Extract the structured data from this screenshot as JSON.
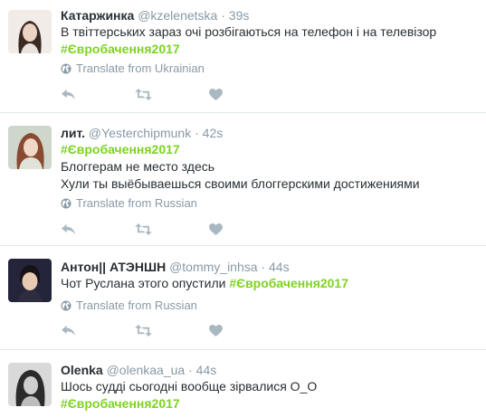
{
  "colors": {
    "hashtag": "#7ed321",
    "muted": "#8899a6",
    "text": "#292f33",
    "divider": "#e1e8ed"
  },
  "icons": {
    "reply": "reply-icon",
    "retweet": "retweet-icon",
    "like": "heart-icon",
    "translate": "globe-icon"
  },
  "tweets": [
    {
      "name": "Катаржинка",
      "handle": "@kzelenetska",
      "separator": "·",
      "time": "39s",
      "lines": [
        "В твіттерських зараз очі розбігаються на телефон і на телевізор"
      ],
      "hashtag": "#Євробачення2017",
      "translate": "Translate from Ukrainian"
    },
    {
      "name": "лит.",
      "handle": "@Yesterchipmunk",
      "separator": "·",
      "time": "42s",
      "hashtag": "#Євробачення2017",
      "lines": [
        "Блоггерам не место здесь",
        "Хули ты выёбываешься своими блоггерскими достижениями"
      ],
      "translate": "Translate from Russian"
    },
    {
      "name": "Антон|| АТЭНШН",
      "handle": "@tommy_inhsa",
      "separator": "·",
      "time": "44s",
      "lines": [
        "Чот Руслана этого опустили "
      ],
      "hashtag": "#Євробачення2017",
      "translate": "Translate from Russian"
    },
    {
      "name": "Olenka",
      "handle": "@olenkaa_ua",
      "separator": "·",
      "time": "44s",
      "lines": [
        "Шось судді сьогодні вообще зірвалися О_О"
      ],
      "hashtag": "#Євробачення2017"
    }
  ]
}
